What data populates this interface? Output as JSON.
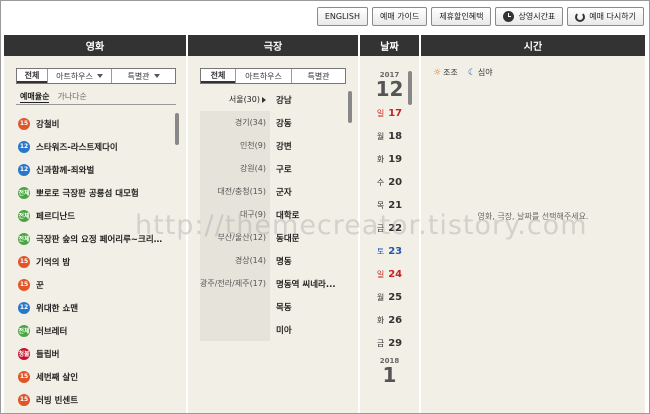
{
  "toolbar": {
    "english": "ENGLISH",
    "guide": "예매 가이드",
    "partner": "제휴할인혜택",
    "schedule": "상영시간표",
    "restart": "예매 다시하기"
  },
  "movie_col": {
    "header": "영화",
    "tabs": [
      "전체",
      "아트하우스",
      "특별관"
    ],
    "sorts": [
      "예매율순",
      "가나다순"
    ],
    "items": [
      {
        "grade": "15",
        "title": "강철비"
      },
      {
        "grade": "12",
        "title": "스타워즈-라스트제다이"
      },
      {
        "grade": "12",
        "title": "신과함께-죄와벌"
      },
      {
        "grade": "전체",
        "title": "뽀로로 극장판 공룡섬 대모험"
      },
      {
        "grade": "전체",
        "title": "페르디난드"
      },
      {
        "grade": "전체",
        "title": "극장판 숲의 요정 페어리루~크리스마..."
      },
      {
        "grade": "15",
        "title": "기억의 밤"
      },
      {
        "grade": "15",
        "title": "꾼"
      },
      {
        "grade": "12",
        "title": "위대한 쇼맨"
      },
      {
        "grade": "전체",
        "title": "러브레터"
      },
      {
        "grade": "청불",
        "title": "들립버"
      },
      {
        "grade": "15",
        "title": "세번째 살인"
      },
      {
        "grade": "15",
        "title": "러빙 빈센트"
      }
    ]
  },
  "theater_col": {
    "header": "극장",
    "tabs": [
      "전체",
      "아트하우스",
      "특별관"
    ],
    "regions": [
      {
        "label": "서울(30)",
        "selected": true
      },
      {
        "label": "경기(34)",
        "selected": false
      },
      {
        "label": "인천(9)",
        "selected": false
      },
      {
        "label": "강원(4)",
        "selected": false
      },
      {
        "label": "대전/충청(15)",
        "selected": false
      },
      {
        "label": "대구(9)",
        "selected": false
      },
      {
        "label": "부산/울산(12)",
        "selected": false
      },
      {
        "label": "경상(14)",
        "selected": false
      },
      {
        "label": "광주/전라/제주(17)",
        "selected": false
      },
      {
        "label": "",
        "selected": false
      },
      {
        "label": "",
        "selected": false
      }
    ],
    "theaters": [
      "강남",
      "강동",
      "강변",
      "구로",
      "군자",
      "대학로",
      "동대문",
      "명동",
      "명동역 씨네라...",
      "목동",
      "미아"
    ]
  },
  "date_col": {
    "header": "날짜",
    "year": "2017",
    "month": "12",
    "dates": [
      {
        "dow": "일",
        "day": "17",
        "type": "sun"
      },
      {
        "dow": "월",
        "day": "18",
        "type": "wk"
      },
      {
        "dow": "화",
        "day": "19",
        "type": "wk"
      },
      {
        "dow": "수",
        "day": "20",
        "type": "wk"
      },
      {
        "dow": "목",
        "day": "21",
        "type": "wk"
      },
      {
        "dow": "금",
        "day": "22",
        "type": "wk"
      },
      {
        "dow": "토",
        "day": "23",
        "type": "sat"
      },
      {
        "dow": "일",
        "day": "24",
        "type": "sun"
      },
      {
        "dow": "월",
        "day": "25",
        "type": "wk"
      },
      {
        "dow": "화",
        "day": "26",
        "type": "wk"
      },
      {
        "dow": "금",
        "day": "29",
        "type": "wk"
      }
    ],
    "next_year": "2018",
    "next_month": "1"
  },
  "time_col": {
    "header": "시간",
    "legend_morning": "조조",
    "legend_night": "심야",
    "hint": "영화, 극장, 날짜를 선택해주세요."
  },
  "watermark": "http://themecreator.tistory.com",
  "colors": {
    "header_bg": "#333333",
    "panel_bg": "#f2f0e6",
    "grade_15": "#e0562a",
    "grade_12": "#2a77c9",
    "grade_all": "#4aa442",
    "grade_18": "#c8102e",
    "sunday": "#cc2020",
    "saturday": "#2156b3"
  }
}
